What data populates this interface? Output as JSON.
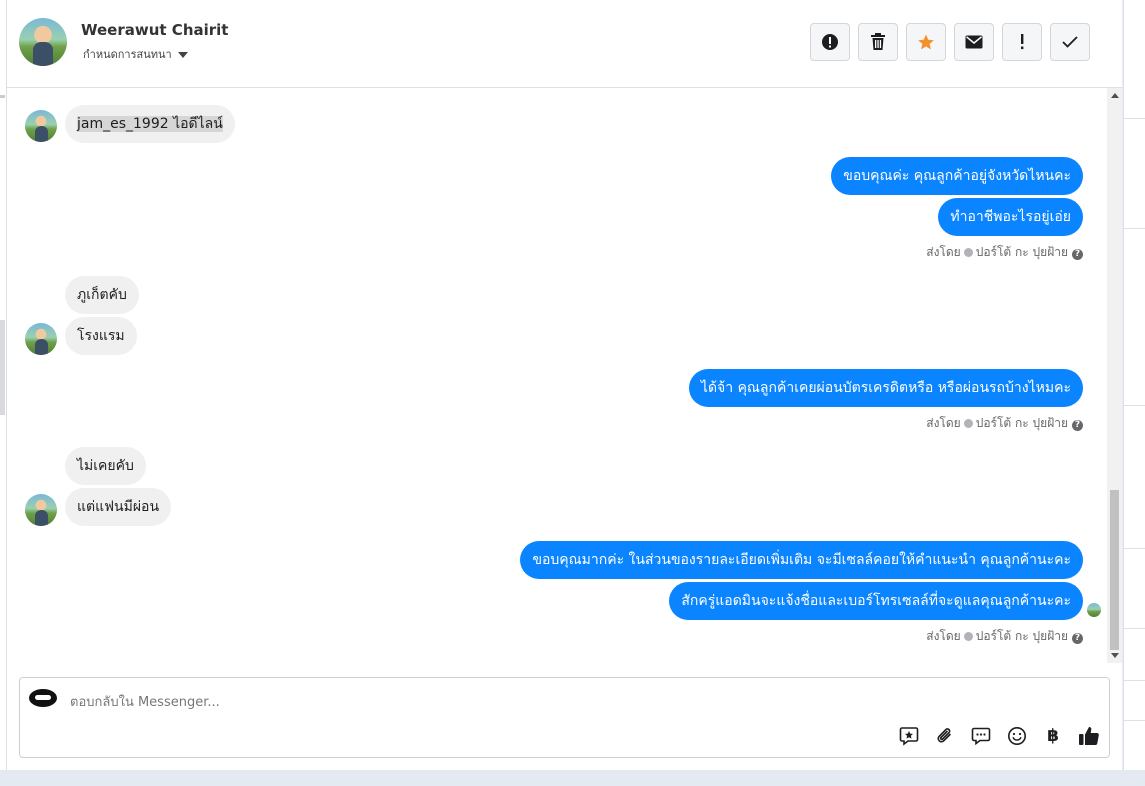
{
  "contact": {
    "name": "Weerawut Chairit",
    "label_select": "กำหนดการสนทนา"
  },
  "header_actions": [
    {
      "id": "spam",
      "icon": "alert-circle-icon"
    },
    {
      "id": "delete",
      "icon": "trash-icon"
    },
    {
      "id": "star",
      "icon": "star-icon",
      "color": "#f5902b"
    },
    {
      "id": "mark-unread",
      "icon": "envelope-icon"
    },
    {
      "id": "important",
      "icon": "exclamation-icon"
    },
    {
      "id": "done",
      "icon": "check-icon"
    }
  ],
  "messages": [
    {
      "dir": "in",
      "text": "jam_es_1992 ไอดีไลน์",
      "highlight": true
    },
    {
      "dir": "out",
      "text": "ขอบคุณค่ะ คุณลูกค้าอยู่จังหวัดไหนคะ"
    },
    {
      "dir": "out",
      "text": "ทำอาชีพอะไรอยู่เอ่ย"
    },
    {
      "dir": "in",
      "text": "ภูเก็ตคับ"
    },
    {
      "dir": "in",
      "text": "โรงแรม"
    },
    {
      "dir": "out",
      "text": "ได้จ้า คุณลูกค้าเคยผ่อนบัตรเครดิตหรือ หรือผ่อนรถบ้างไหมคะ"
    },
    {
      "dir": "in",
      "text": "ไม่เคยคับ"
    },
    {
      "dir": "in",
      "text": "แต่แฟนมีผ่อน"
    },
    {
      "dir": "out",
      "text": "ขอบคุณมากค่ะ ในส่วนของรายละเอียดเพิ่มเติม จะมีเซลล์คอยให้คำแนะนำ คุณลูกค้านะคะ"
    },
    {
      "dir": "out",
      "text": "สักครู่แอดมินจะแจ้งชื่อและเบอร์โทรเซลล์ที่จะดูแลคุณลูกค้านะคะ"
    }
  ],
  "sent_by": {
    "prefix": "ส่งโดย",
    "sender": "ปอร์โต้ กะ ปุยฝ้าย",
    "help": "?"
  },
  "composer": {
    "placeholder": "ตอบกลับใน Messenger...",
    "value": "",
    "tools": [
      "saved-reply-icon",
      "paperclip-icon",
      "chat-bubble-icon",
      "smiley-icon",
      "baht-icon",
      "thumbs-up-icon"
    ],
    "baht_symbol": "฿"
  },
  "colors": {
    "accent_blue": "#0b84ff",
    "incoming_bubble": "#f0f0f0",
    "star_orange": "#f5902b"
  }
}
